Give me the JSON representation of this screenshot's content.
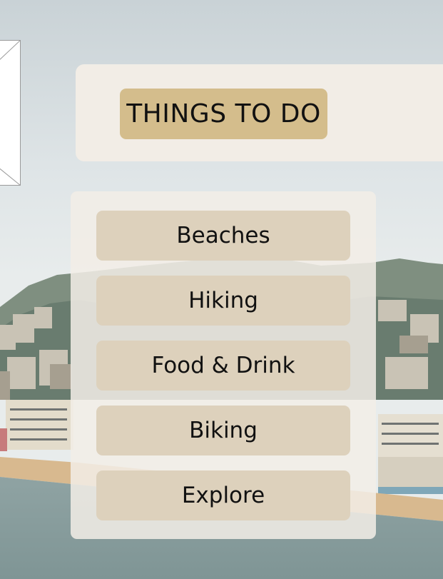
{
  "header": {
    "title": "THINGS TO DO"
  },
  "menu": {
    "items": [
      {
        "label": "Beaches"
      },
      {
        "label": "Hiking"
      },
      {
        "label": "Food & Drink"
      },
      {
        "label": "Biking"
      },
      {
        "label": "Explore"
      }
    ]
  },
  "theme": {
    "panel_color": "#f2ede6",
    "title_chip_color": "#d4bd8c",
    "button_color": "#ddd1bc",
    "text_color": "#111111"
  }
}
